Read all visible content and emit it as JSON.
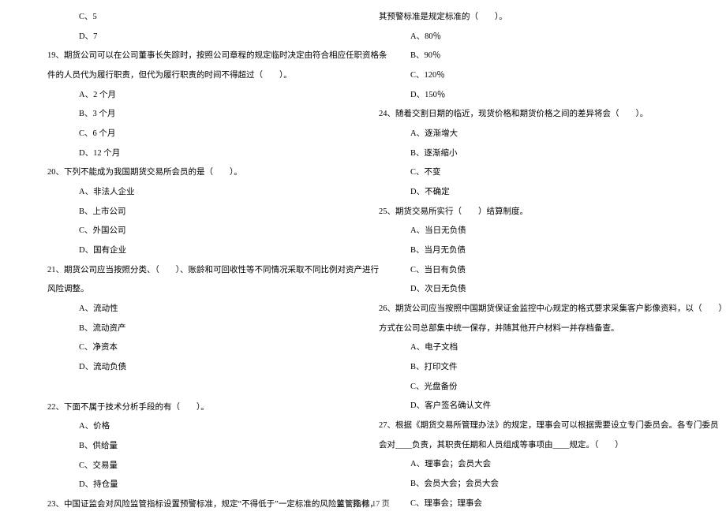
{
  "left": {
    "opt_c_18": "C、5",
    "opt_d_18": "D、7",
    "q19": "19、期货公司可以在公司董事长失踪时，按照公司章程的规定临时决定由符合相应任职资格条",
    "q19_cont": "件的人员代为履行职责，但代为履行职责的时间不得超过（　　）。",
    "q19_a": "A、2 个月",
    "q19_b": "B、3 个月",
    "q19_c": "C、6 个月",
    "q19_d": "D、12 个月",
    "q20": "20、下列不能成为我国期货交易所会员的是（　　）。",
    "q20_a": "A、非法人企业",
    "q20_b": "B、上市公司",
    "q20_c": "C、外国公司",
    "q20_d": "D、国有企业",
    "q21": "21、期货公司应当按照分类、（　　）、账龄和可回收性等不同情况采取不同比例对资产进行",
    "q21_cont": "风险调整。",
    "q21_a": "A、流动性",
    "q21_b": "B、流动资产",
    "q21_c": "C、净资本",
    "q21_d": "D、流动负债",
    "q22": "22、下面不属于技术分析手段的有（　　）。",
    "q22_a": "A、价格",
    "q22_b": "B、供给量",
    "q22_c": "C、交易量",
    "q22_d": "D、持仓量",
    "q23": "23、中国证监会对风险监管指标设置预警标准，规定“不得低于”一定标准的风险监管指标，"
  },
  "right": {
    "q23_cont": "其预警标准是规定标准的（　　）。",
    "q23_a": "A、80％",
    "q23_b": "B、90％",
    "q23_c": "C、120％",
    "q23_d": "D、150％",
    "q24": "24、随着交割日期的临近，现货价格和期货价格之间的差异将会（　　）。",
    "q24_a": "A、逐渐增大",
    "q24_b": "B、逐渐缩小",
    "q24_c": "C、不变",
    "q24_d": "D、不确定",
    "q25": "25、期货交易所实行（　　）结算制度。",
    "q25_a": "A、当日无负债",
    "q25_b": "B、当月无负债",
    "q25_c": "C、当日有负债",
    "q25_d": "D、次日无负债",
    "q26": "26、期货公司应当按照中国期货保证金监控中心规定的格式要求采集客户影像资料，以（　　）",
    "q26_cont": "方式在公司总部集中统一保存，并随其他开户材料一并存档备查。",
    "q26_a": "A、电子文档",
    "q26_b": "B、打印文件",
    "q26_c": "C、光盘备份",
    "q26_d": "D、客户签名确认文件",
    "q27": "27、根据《期货交易所管理办法》的规定，理事会可以根据需要设立专门委员会。各专门委员",
    "q27_cont": "会对____负责，其职责任期和人员组成等事项由____规定。（　　）",
    "q27_a": "A、理事会；会员大会",
    "q27_b": "B、会员大会；会员大会",
    "q27_c": "C、理事会；理事会"
  },
  "footer": "第 3 页 共 17 页"
}
